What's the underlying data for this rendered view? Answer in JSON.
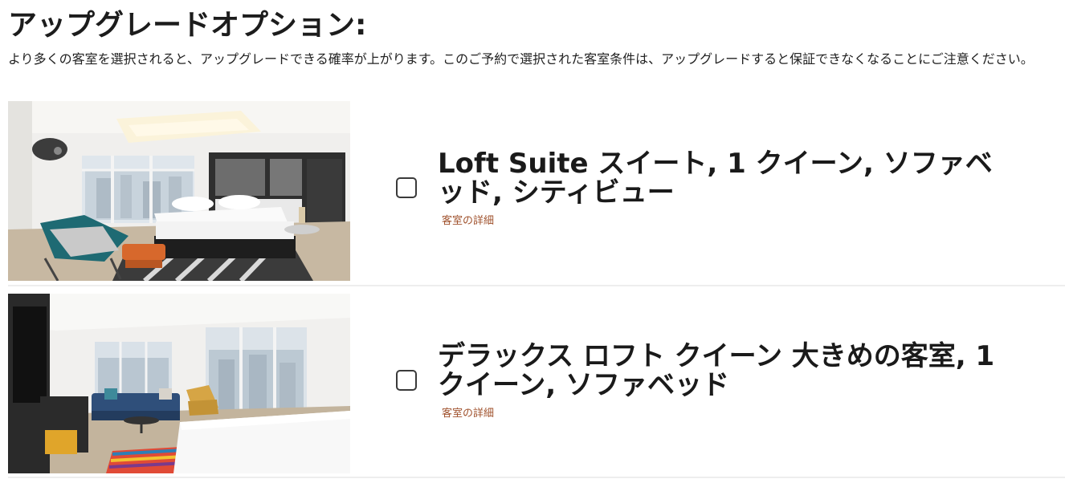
{
  "heading": "アップグレードオプション:",
  "intro": "より多くの客室を選択されると、アップグレードできる確率が上がります。このご予約で選択された客室条件は、アップグレードすると保証できなくなることにご注意ください。",
  "rooms": [
    {
      "title": "Loft Suite スイート, 1 クイーン, ソファベッド, シティビュー",
      "details_link": "客室の詳細",
      "selected": false
    },
    {
      "title": "デラックス ロフト クイーン 大きめの客室, 1 クイーン, ソファベッド",
      "details_link": "客室の詳細",
      "selected": false
    }
  ],
  "colors": {
    "link": "#a0522d",
    "divider": "#eeeeee"
  }
}
